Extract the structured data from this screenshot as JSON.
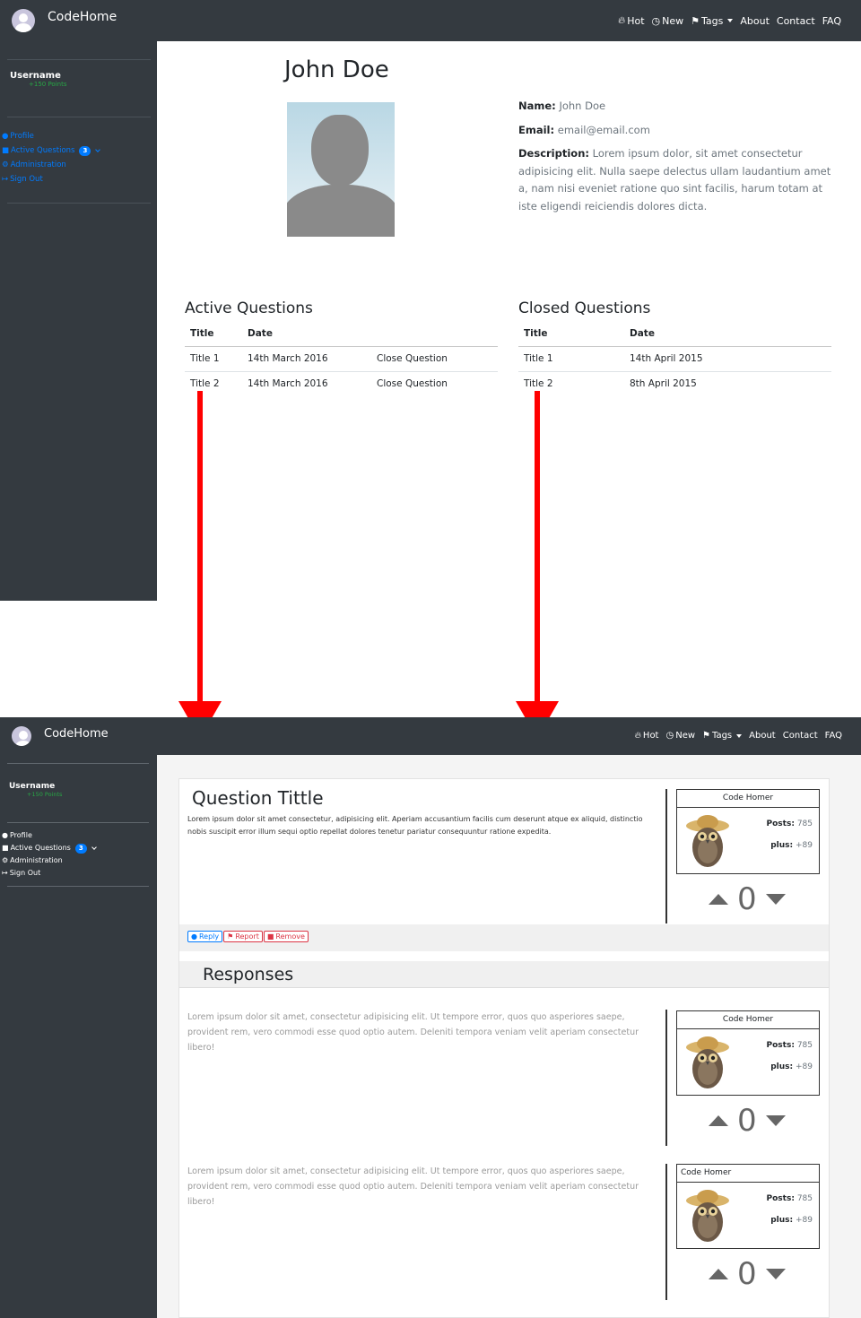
{
  "brand": "CodeHome",
  "nav": [
    "Hot",
    "New",
    "Tags",
    "About",
    "Contact",
    "FAQ"
  ],
  "sidebar": {
    "username": "Username",
    "points": "+150 Points",
    "items": [
      {
        "label": "Profile",
        "icon": "user-icon"
      },
      {
        "label": "Active Questions",
        "icon": "book-icon",
        "badge": "3"
      },
      {
        "label": "Administration",
        "icon": "cogs-icon"
      },
      {
        "label": "Sign Out",
        "icon": "sign-out-icon"
      }
    ]
  },
  "profile": {
    "name": "John Doe",
    "name_label": "Name:",
    "name_value": "John Doe",
    "email_label": "Email:",
    "email_value": "email@email.com",
    "description_label": "Description:",
    "description_value": "Lorem ipsum dolor, sit amet consectetur adipisicing elit. Nulla saepe delectus ullam laudantium amet a, nam nisi eveniet ratione quo sint facilis, harum totam at iste eligendi reiciendis dolores dicta."
  },
  "active_questions": {
    "title": "Active Questions",
    "headers": [
      "Title",
      "Date"
    ],
    "rows": [
      {
        "title": "Title 1",
        "date": "14th March 2016",
        "action": "Close Question"
      },
      {
        "title": "Title 2",
        "date": "14th March 2016",
        "action": "Close Question"
      }
    ]
  },
  "closed_questions": {
    "title": "Closed Questions",
    "headers": [
      "Title",
      "Date"
    ],
    "rows": [
      {
        "title": "Title 1",
        "date": "14th April 2015"
      },
      {
        "title": "Title 2",
        "date": "8th April 2015"
      }
    ]
  },
  "question": {
    "title": "Question Tittle",
    "body": "Lorem ipsum dolor sit amet consectetur, adipisicing elit. Aperiam accusantium facilis cum deserunt atque ex aliquid, distinctio nobis suscipit error illum sequi optio repellat dolores tenetur pariatur consequuntur ratione expedita.",
    "actions": [
      "Reply",
      "Report",
      "Remove"
    ],
    "responses_title": "Responses"
  },
  "user_card": {
    "name": "Code Homer",
    "posts_label": "Posts:",
    "posts_value": "785",
    "plus_label": "plus:",
    "plus_value": "+89",
    "votes": "0"
  },
  "response_text": "Lorem ipsum dolor sit amet, consectetur adipisicing elit. Ut tempore error, quos quo asperiores saepe, provident rem, vero commodi esse quod optio autem. Deleniti tempora veniam velit aperiam consectetur libero!",
  "colors": {
    "dark": "#343a40",
    "link": "#007bff",
    "success": "#28a745",
    "danger": "#dc3545",
    "arrow": "#ff0000"
  }
}
